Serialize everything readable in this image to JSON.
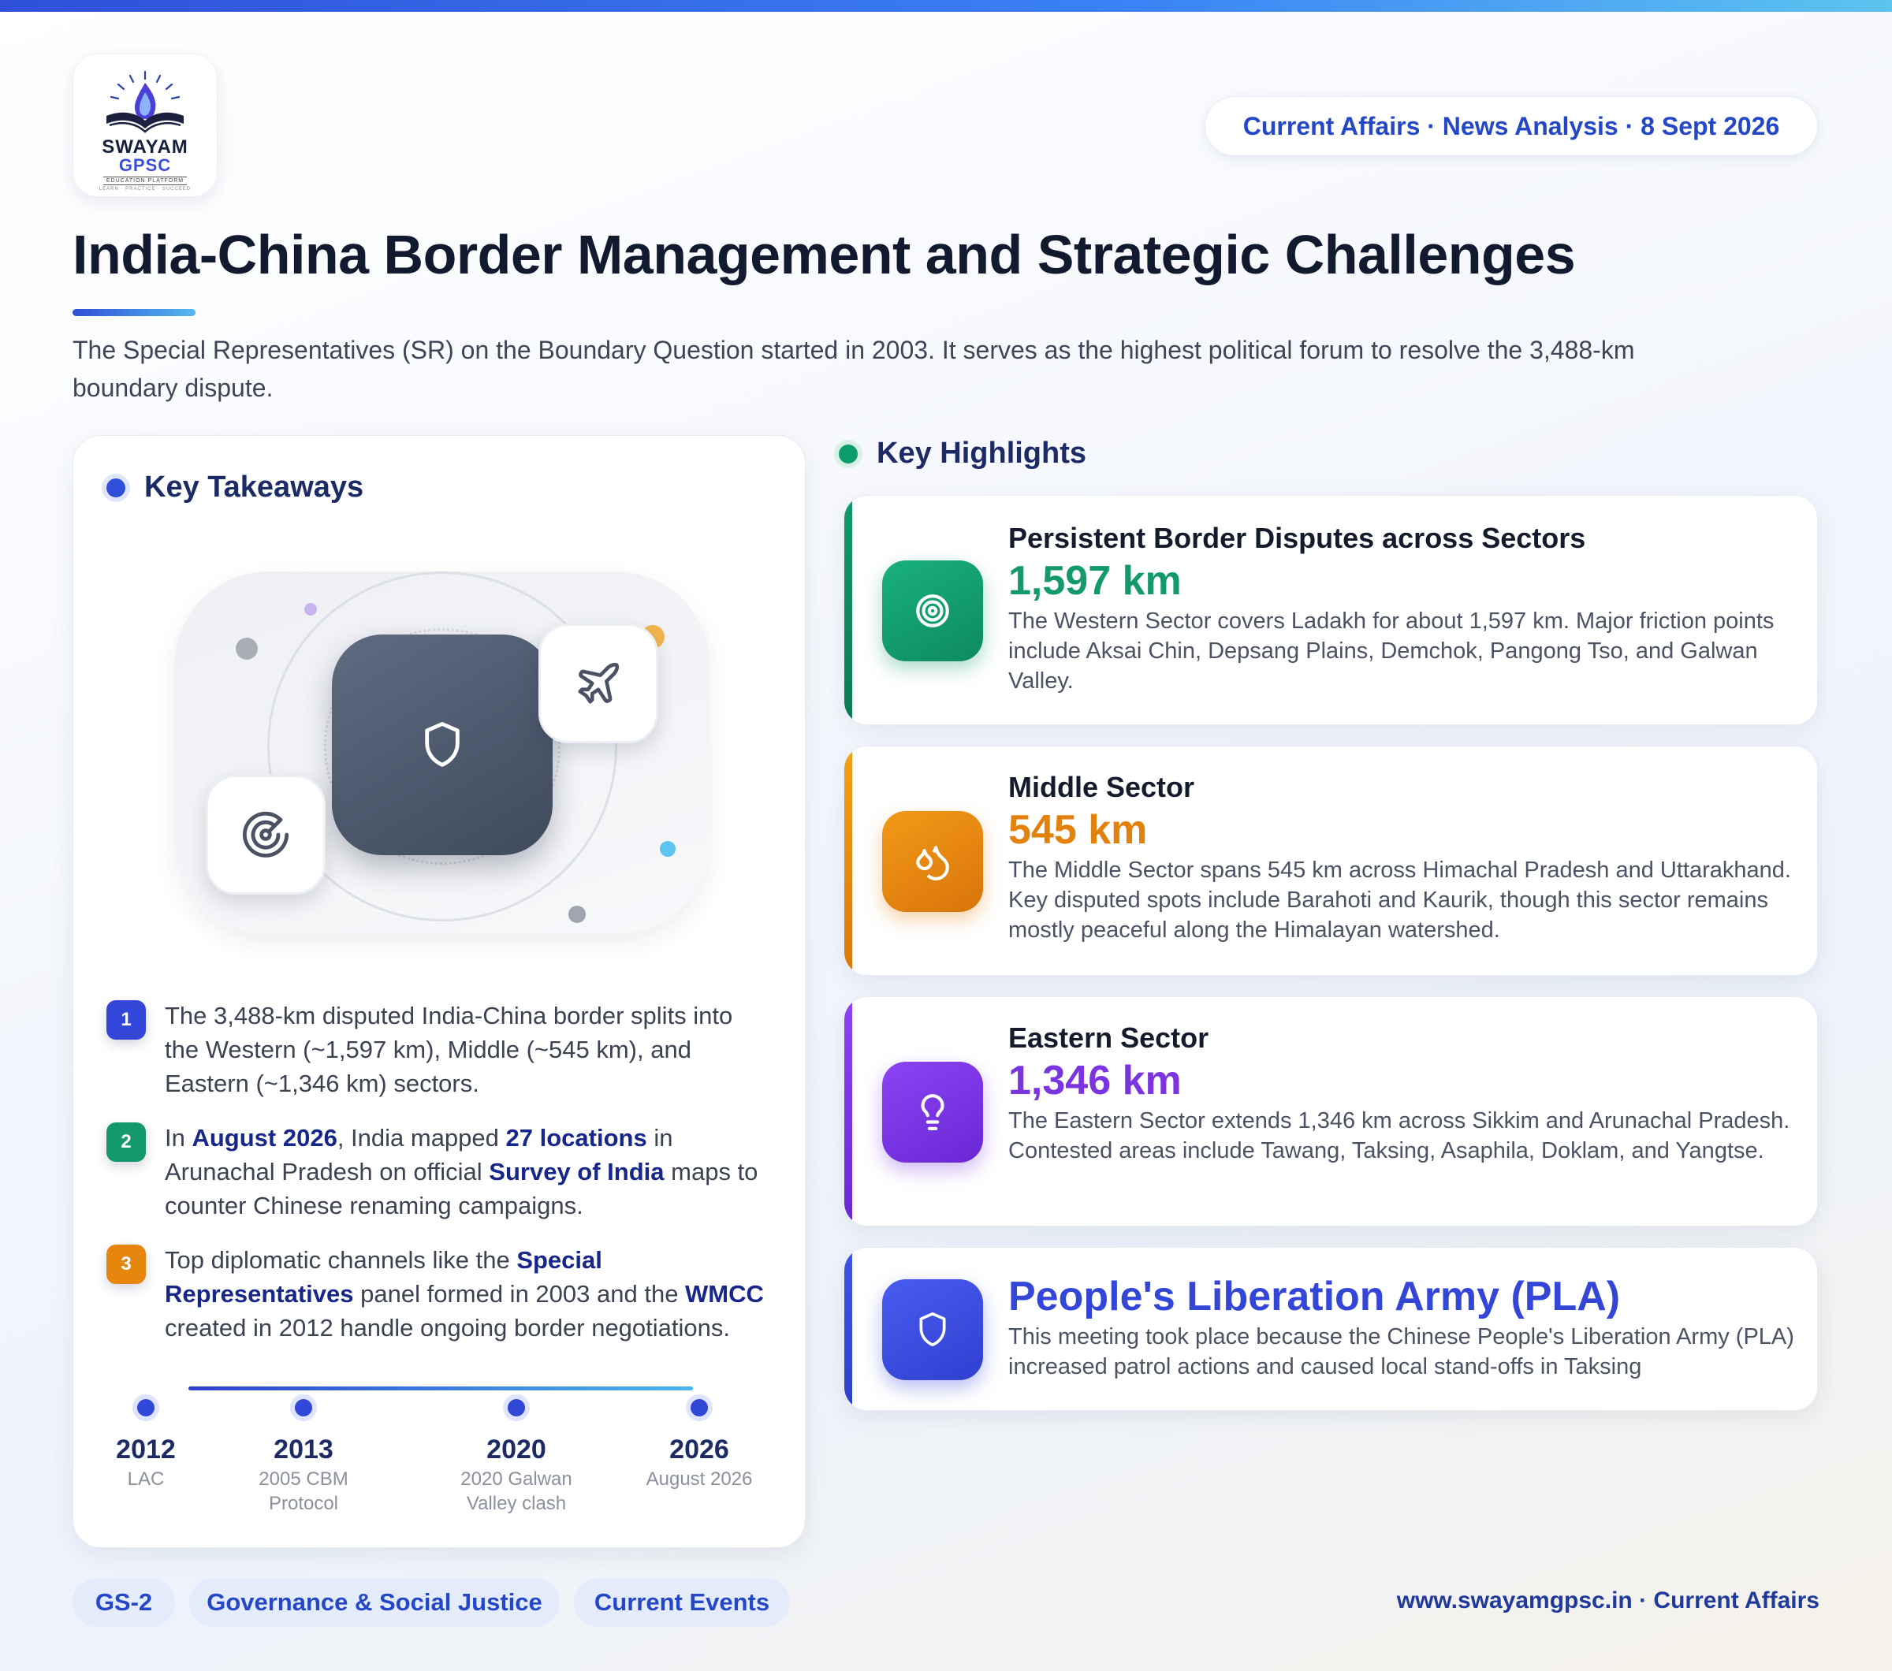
{
  "brand": {
    "name": "SWAYAM",
    "sub": "GPSC",
    "tag": "EDUCATION PLATFORM",
    "tag2": "LEARN · PRACTICE · SUCCEED"
  },
  "header": {
    "pill": "Current Affairs · News Analysis · 8 Sept 2026",
    "title": "India-China Border Management and Strategic Challenges",
    "intro": "The Special Representatives (SR) on the Boundary Question started in 2003. It serves as the highest political forum to resolve the 3,488-km boundary dispute."
  },
  "left": {
    "heading": "Key Takeaways",
    "icons": [
      "shield-icon",
      "plane-icon",
      "radar-icon"
    ],
    "takeaways": [
      {
        "num": "1",
        "parts": [
          {
            "t": "The 3,488-km disputed India-China border splits into the Western (~1,597 km), Middle (~545 km), and Eastern (~1,346 km) sectors.",
            "b": false
          }
        ]
      },
      {
        "num": "2",
        "parts": [
          {
            "t": "In ",
            "b": false
          },
          {
            "t": "August 2026",
            "b": true
          },
          {
            "t": ", India mapped ",
            "b": false
          },
          {
            "t": "27 locations",
            "b": true
          },
          {
            "t": " in Arunachal Pradesh on official ",
            "b": false
          },
          {
            "t": "Survey of India",
            "b": true
          },
          {
            "t": " maps to counter Chinese renaming campaigns.",
            "b": false
          }
        ]
      },
      {
        "num": "3",
        "parts": [
          {
            "t": "Top diplomatic channels like the ",
            "b": false
          },
          {
            "t": "Special Representatives",
            "b": true
          },
          {
            "t": " panel formed in 2003 and the ",
            "b": false
          },
          {
            "t": "WMCC",
            "b": true
          },
          {
            "t": " created in 2012 handle ongoing border negotiations.",
            "b": false
          }
        ]
      }
    ],
    "timeline": [
      {
        "year": "2012",
        "label": "LAC"
      },
      {
        "year": "2013",
        "label": "2005 CBM Protocol"
      },
      {
        "year": "2020",
        "label": "2020 Galwan Valley clash"
      },
      {
        "year": "2026",
        "label": "August 2026"
      }
    ]
  },
  "right": {
    "heading": "Key Highlights",
    "cards": [
      {
        "title": "Persistent Border Disputes across Sectors",
        "value": "1,597 km",
        "desc": "The Western Sector covers Ladakh for about 1,597 km. Major friction points include Aksai Chin, Depsang Plains, Demchok, Pangong Tso, and Galwan Valley.",
        "icon": "target-icon",
        "color": "#13996d"
      },
      {
        "title": "Middle Sector",
        "value": "545 km",
        "desc": "The Middle Sector spans 545 km across Himachal Pradesh and Uttarakhand. Key disputed spots include Barahoti and Kaurik, though this sector remains mostly peaceful along the Himalayan watershed.",
        "icon": "droplets-icon",
        "color": "#e2820c"
      },
      {
        "title": "Eastern Sector",
        "value": "1,346 km",
        "desc": "The Eastern Sector extends 1,346 km across Sikkim and Arunachal Pradesh. Contested areas include Tawang, Taksing, Asaphila, Doklam, and Yangtse.",
        "icon": "lightbulb-icon",
        "color": "#7a34e0"
      },
      {
        "title": "People's Liberation Army (PLA)",
        "desc": "This meeting took place because the Chinese People's Liberation Army (PLA) increased patrol actions and caused local stand-offs in Taksing",
        "icon": "shield-icon",
        "color": "#3446d8"
      }
    ]
  },
  "footer": {
    "tags": [
      "GS-2",
      "Governance & Social Justice",
      "Current Events"
    ],
    "site": "www.swayamgpsc.in · Current Affairs"
  }
}
